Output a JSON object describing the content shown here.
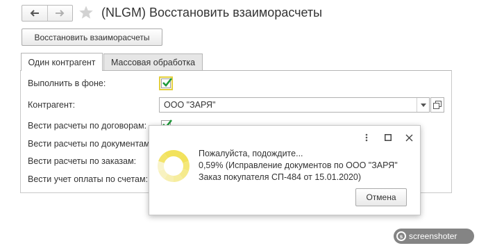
{
  "window": {
    "title": "(NLGM) Восстановить взаиморасчеты"
  },
  "toolbar": {
    "restore_label": "Восстановить взаиморасчеты"
  },
  "tabs": [
    {
      "label": "Один контрагент",
      "active": true
    },
    {
      "label": "Массовая обработка",
      "active": false
    }
  ],
  "form": {
    "run_in_background_label": "Выполнить в фоне:",
    "run_in_background_checked": true,
    "counterparty_label": "Контрагент:",
    "counterparty_value": "ООО \"ЗАРЯ\"",
    "by_contracts_label": "Вести расчеты по договорам:",
    "by_contracts_checked": true,
    "by_documents_label": "Вести расчеты по документам:",
    "by_orders_label": "Вести расчеты по заказам:",
    "by_invoices_label": "Вести учет оплаты по счетам:"
  },
  "dialog": {
    "line1": "Пожалуйста, подождите...",
    "line2": "0,59% (Исправление документов по ООО \"ЗАРЯ\"",
    "line3": "Заказ покупателя СП-484 от 15.01.2020)",
    "cancel_label": "Отмена",
    "progress_percent": 0.59
  },
  "watermark": {
    "text": "screenshoter"
  },
  "colors": {
    "check_green": "#1f9a3a",
    "focus_yellow": "#e3cf3d",
    "spinner_yellow": "#f2e25c",
    "spinner_light": "#f7efb0"
  },
  "icons": [
    "back-arrow-icon",
    "forward-arrow-icon",
    "favorite-star-icon",
    "dropdown-arrow-icon",
    "open-window-icon",
    "more-options-icon",
    "maximize-icon",
    "close-icon",
    "spinner-icon",
    "screenshoter-logo-icon"
  ]
}
